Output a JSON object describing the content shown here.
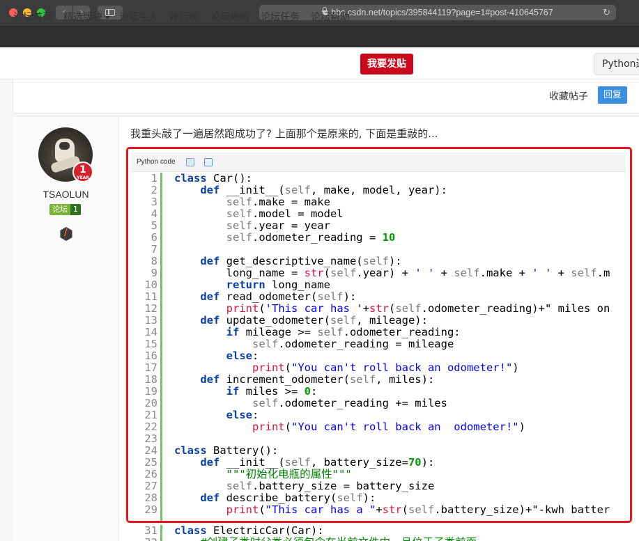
{
  "browser": {
    "url": "bbs.csdn.net/topics/395844119?page=1#post-410645767"
  },
  "nav": {
    "items": [
      "论坛首页",
      "精选版块",
      "论坛牛人",
      "排行榜",
      "论坛地图",
      "论坛任务",
      "论坛帮助"
    ],
    "post_button": "我要发贴",
    "category_button": "Python进"
  },
  "post_actions": {
    "favorite": "收藏帖子",
    "reply": "回复"
  },
  "user": {
    "name": "TSAOLUN",
    "badge_number": "1",
    "badge_year": "YEAR",
    "level_label": "论坛",
    "level_value": "1"
  },
  "post": {
    "text": "我重头敲了一遍居然跑成功了? 上面那个是原来的, 下面是重敲的...",
    "code_label": "Python code"
  },
  "code_lines": [
    {
      "n": "1",
      "text": "class Car():"
    },
    {
      "n": "2",
      "text": "    def __init__(self, make, model, year):"
    },
    {
      "n": "3",
      "text": "        self.make = make"
    },
    {
      "n": "4",
      "text": "        self.model = model"
    },
    {
      "n": "5",
      "text": "        self.year = year"
    },
    {
      "n": "6",
      "text": "        self.odometer_reading = 10"
    },
    {
      "n": "7",
      "text": ""
    },
    {
      "n": "8",
      "text": "    def get_descriptive_name(self):"
    },
    {
      "n": "9",
      "text": "        long_name = str(self.year) + ' ' + self.make + ' ' + self.m"
    },
    {
      "n": "10",
      "text": "        return long_name"
    },
    {
      "n": "11",
      "text": "    def read_odometer(self):"
    },
    {
      "n": "12",
      "text": "        print('This car has '+str(self.odometer_reading)+\" miles on"
    },
    {
      "n": "13",
      "text": "    def update_odometer(self, mileage):"
    },
    {
      "n": "14",
      "text": "        if mileage >= self.odometer_reading:"
    },
    {
      "n": "15",
      "text": "            self.odometer_reading = mileage"
    },
    {
      "n": "16",
      "text": "        else:"
    },
    {
      "n": "17",
      "text": "            print(\"You can't roll back an odometer!\")"
    },
    {
      "n": "18",
      "text": "    def increment_odometer(self, miles):"
    },
    {
      "n": "19",
      "text": "        if miles >= 0:"
    },
    {
      "n": "20",
      "text": "            self.odometer_reading += miles"
    },
    {
      "n": "21",
      "text": "        else:"
    },
    {
      "n": "22",
      "text": "            print(\"You can't roll back an  odometer!\")"
    },
    {
      "n": "23",
      "text": ""
    },
    {
      "n": "24",
      "text": "class Battery():"
    },
    {
      "n": "25",
      "text": "    def __init__(self, battery_size=70):"
    },
    {
      "n": "26",
      "text": "        \"\"\"初始化电瓶的属性\"\"\""
    },
    {
      "n": "27",
      "text": "        self.battery_size = battery_size"
    },
    {
      "n": "28",
      "text": "    def describe_battery(self):"
    },
    {
      "n": "29",
      "text": "        print(\"This car has a \"+str(self.battery_size)+\"-kwh batter"
    }
  ],
  "code_lines_below": [
    {
      "n": "31",
      "text": "class ElectricCar(Car):"
    },
    {
      "n": "32",
      "text": "    #创建子类时父类必须包含在当前文件中，且位于子类前面"
    }
  ],
  "colors": {
    "highlight_border": "#e8161c",
    "post_button": "#c9091b",
    "reply_button": "#3b8fe0",
    "keyword": "#0b40a8",
    "string": "#0000ff",
    "number": "#009900",
    "builtin": "#dc143c",
    "gutter_line": "#6ec66c"
  }
}
